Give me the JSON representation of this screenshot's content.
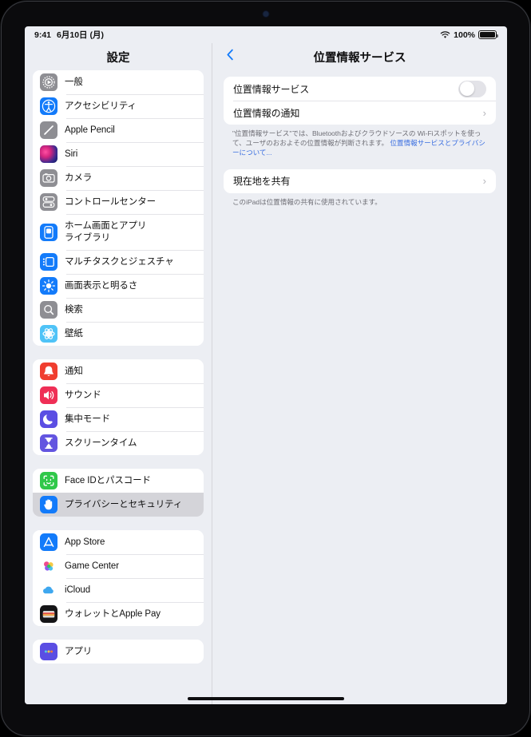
{
  "statusbar": {
    "time": "9:41",
    "date": "6月10日 (月)",
    "battery_percent": "100%",
    "wifi_icon": "wifi-icon",
    "battery_icon": "battery-full-icon"
  },
  "sidebar": {
    "title": "設定",
    "selected_item": "プライバシーとセキュリティ",
    "groups": [
      {
        "items": [
          {
            "label": "一般",
            "icon": "gear-icon"
          },
          {
            "label": "アクセシビリティ",
            "icon": "accessibility-icon"
          },
          {
            "label": "Apple Pencil",
            "icon": "pencil-icon"
          },
          {
            "label": "Siri",
            "icon": "siri-icon"
          },
          {
            "label": "カメラ",
            "icon": "camera-icon"
          },
          {
            "label": "コントロールセンター",
            "icon": "control-center-icon"
          },
          {
            "label": "ホーム画面とアプリ\nライブラリ",
            "icon": "home-screen-icon"
          },
          {
            "label": "マルチタスクとジェスチャ",
            "icon": "multitasking-icon"
          },
          {
            "label": "画面表示と明るさ",
            "icon": "brightness-icon"
          },
          {
            "label": "検索",
            "icon": "search-icon"
          },
          {
            "label": "壁紙",
            "icon": "wallpaper-icon"
          }
        ]
      },
      {
        "items": [
          {
            "label": "通知",
            "icon": "bell-icon"
          },
          {
            "label": "サウンド",
            "icon": "speaker-icon"
          },
          {
            "label": "集中モード",
            "icon": "moon-icon"
          },
          {
            "label": "スクリーンタイム",
            "icon": "hourglass-icon"
          }
        ]
      },
      {
        "items": [
          {
            "label": "Face IDとパスコード",
            "icon": "face-id-icon"
          },
          {
            "label": "プライバシーとセキュリティ",
            "icon": "hand-raised-icon"
          }
        ]
      },
      {
        "items": [
          {
            "label": "App Store",
            "icon": "app-store-icon"
          },
          {
            "label": "Game Center",
            "icon": "game-center-icon"
          },
          {
            "label": "iCloud",
            "icon": "icloud-icon"
          },
          {
            "label": "ウォレットとApple Pay",
            "icon": "wallet-icon"
          }
        ]
      },
      {
        "items": [
          {
            "label": "アプリ",
            "icon": "apps-icon"
          }
        ]
      }
    ]
  },
  "detail": {
    "title": "位置情報サービス",
    "back_icon": "chevron-left-icon",
    "section_one": {
      "toggle_row": {
        "label": "位置情報サービス",
        "toggle_state": "off"
      },
      "alerts_row": {
        "label": "位置情報の通知",
        "chevron": "chevron-right-icon"
      },
      "footnote_text": "\"位置情報サービス\"では、Bluetoothおよびクラウドソースの Wi-Fiスポットを使って、ユーザのおおよその位置情報が判断されます。 ",
      "footnote_link": "位置情報サービスとプライバシーについて..."
    },
    "section_two": {
      "share_row": {
        "label": "現在地を共有",
        "chevron": "chevron-right-icon"
      },
      "footnote_text": "このiPadは位置情報の共有に使用されています。"
    }
  },
  "colors": {
    "accent_blue": "#137bfa",
    "link_blue": "#3b6fe0",
    "screen_bg": "#eceef3",
    "card_bg": "#ffffff",
    "selected_row": "#d4d4d9"
  }
}
